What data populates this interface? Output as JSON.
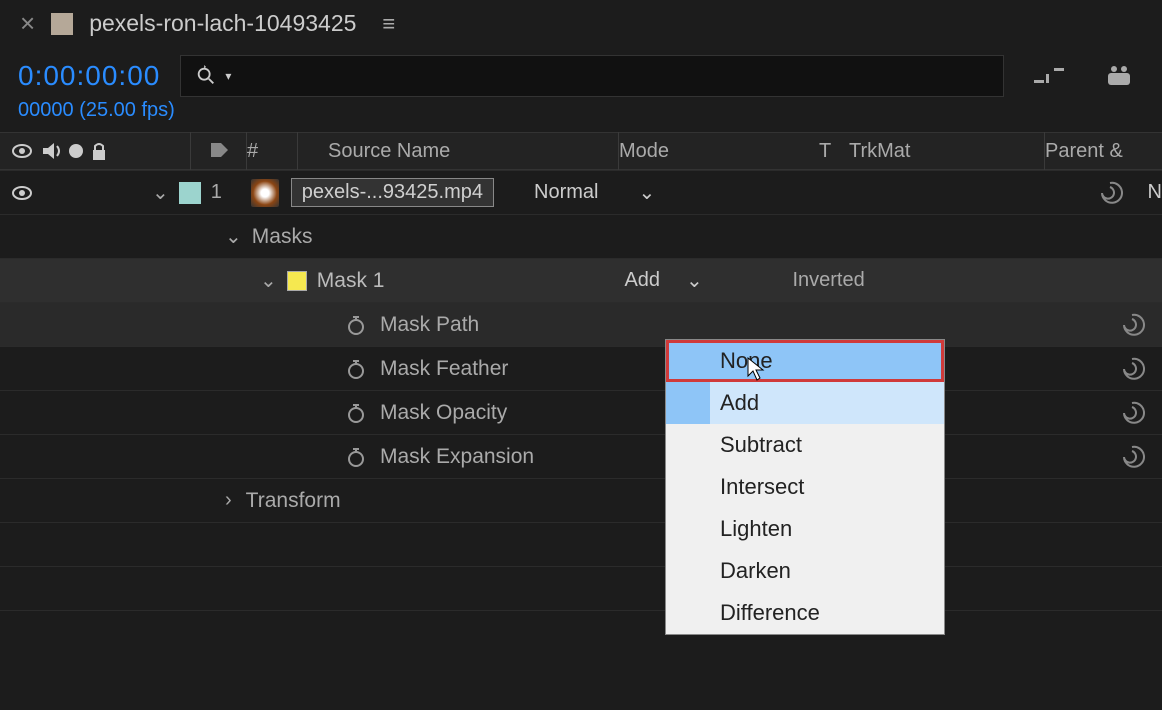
{
  "tab": {
    "title": "pexels-ron-lach-10493425"
  },
  "timecode": "0:00:00:00",
  "framerate": "00000 (25.00 fps)",
  "columns": {
    "num": "#",
    "sourcename": "Source Name",
    "mode": "Mode",
    "t": "T",
    "trkmat": "TrkMat",
    "parent": "Parent &"
  },
  "layer": {
    "index": "1",
    "name": "pexels-...93425.mp4",
    "mode": "Normal",
    "parent_letter": "N"
  },
  "masks": {
    "header": "Masks",
    "mask1": {
      "name": "Mask 1",
      "mode": "Add",
      "inverted_label": "Inverted",
      "props": {
        "path": "Mask Path",
        "feather": "Mask Feather",
        "opacity": "Mask Opacity",
        "expansion": "Mask Expansion"
      }
    }
  },
  "transform": {
    "label": "Transform"
  },
  "mode_menu": {
    "highlighted": "None",
    "items": [
      "None",
      "Add",
      "Subtract",
      "Intersect",
      "Lighten",
      "Darken",
      "Difference"
    ],
    "selected": "Add"
  }
}
